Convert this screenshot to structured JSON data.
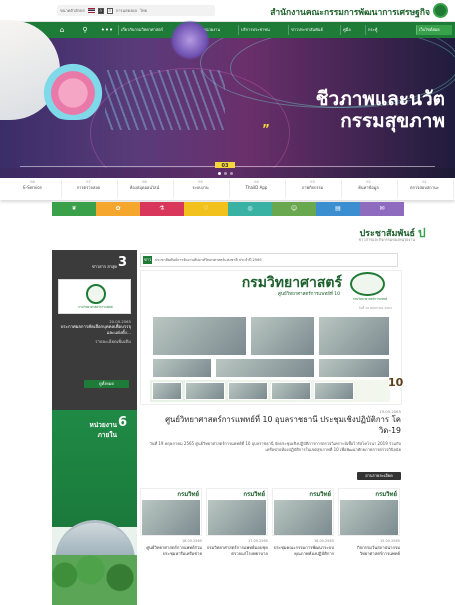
{
  "topbar": {
    "font_label": "ขนาดตัวอักษร",
    "contrast_label": "การแสดงผล",
    "lang_label": "ไทย",
    "size_a": "ก",
    "size_b": "ก",
    "site_title": "สำนักงานคณะกรรมการพัฒนาการเศรษฐกิจ",
    "nav_icons": [
      "home-icon",
      "search-icon",
      "more-icon"
    ],
    "nav_items": [
      "เกี่ยวกับกรมวิทยาศาสตร์",
      "ข้อมูลหน่วยงาน",
      "บริการประชาชน",
      "ข่าวประชาสัมพันธ์",
      "คู่มือ",
      "กระทู้"
    ],
    "nav_sub": "เว็บไซต์ย่อย"
  },
  "banner": {
    "title_line1": "ชีวภาพและนวัต",
    "title_line2": "กรรมสุขภาพ",
    "quote": "”",
    "slide_number": "03"
  },
  "quick_menu": [
    {
      "num": "01",
      "label": "ตรวจสอบสถานะ"
    },
    {
      "num": "02",
      "label": "ค้นหาข้อมูล"
    },
    {
      "num": "03",
      "label": "ภาพกิจกรรม"
    },
    {
      "num": "04",
      "label": "ThaiID App"
    },
    {
      "num": "05",
      "label": "ระบบงาน"
    },
    {
      "num": "06",
      "label": "ห้องสมุดออนไลน์"
    },
    {
      "num": "07",
      "label": "การตรวจสอบ"
    },
    {
      "num": "08",
      "label": "E-Service"
    }
  ],
  "colorbar": [
    {
      "icon": "leaf-icon",
      "color": "#3aa04a"
    },
    {
      "icon": "palette-icon",
      "color": "#f5a62d"
    },
    {
      "icon": "tube-icon",
      "color": "#d9365b"
    },
    {
      "icon": "heart-icon",
      "color": "#f3c11b"
    },
    {
      "icon": "globe-icon",
      "color": "#39b2a3"
    },
    {
      "icon": "people-icon",
      "color": "#6aa84f"
    },
    {
      "icon": "doc-icon",
      "color": "#3b8fd0"
    },
    {
      "icon": "chat-icon",
      "color": "#8e6bbf"
    }
  ],
  "section": {
    "title": "ประชาสัมพันธ์",
    "subtitle": "ข่าวสารและกิจกรรมของหน่วยงาน",
    "icon_letter": "ป"
  },
  "left_col": {
    "head_num": "3",
    "head_label": "ข่าวสาร ล่าสุด",
    "logo_text": "กรมวิทยาศาสตร์การแพทย์",
    "date": "20.05.2565",
    "text": "ประกาศผลการคัดเลือกบุคคลเพื่อบรรจุและแต่งตั้ง...",
    "text2": "รายละเอียดเพิ่มเติม",
    "button": "ดูทั้งหมด",
    "green_num": "6",
    "green_title": "หน่วยงานภายใน"
  },
  "news_bar": {
    "badge": "ข่าว",
    "text": "ประชาสัมพันธ์การจัดงานสัปดาห์วิทยาศาสตร์แห่งชาติ ประจำปี 2565"
  },
  "feature": {
    "np_title": "กรมวิทยาศาสตร์",
    "np_sub": "ศูนย์วิทยาศาสตร์การแพทย์ที่ 10",
    "np_logo_text": "กรมวิทยาศาสตร์การแพทย์",
    "meta": "วันที่ 19 พฤษภาคม 2565",
    "num": "10"
  },
  "news": {
    "date": "19.05.2565",
    "headline": "ศูนย์วิทยาศาสตร์การแพทย์ที่ 10 อุบลราชธานี ประชุมเชิงปฏิบัติการ โควิด-19",
    "body": "วันที่ 19 พฤษภาคม 2565 ศูนย์วิทยาศาสตร์การแพทย์ที่ 10 อุบลราชธานี จัดประชุมเชิงปฏิบัติการการตรวจวิเคราะห์เชื้อไวรัสโคโรนา 2019 ร่วมกับเครือข่ายห้องปฏิบัติการในเขตสุขภาพที่ 10 เพื่อพัฒนาศักยภาพการตรวจวินิจฉัย",
    "read_more": "อ่านรายละเอียด"
  },
  "thumbs": [
    {
      "hd": "กรมวิทย์",
      "date": "18.05.2565",
      "text": "ศูนย์วิทยาศาสตร์การแพทย์ร่วมประชุมหารือเครือข่าย"
    },
    {
      "hd": "กรมวิทย์",
      "date": "17.05.2565",
      "text": "กรมวิทยาศาสตร์การแพทย์มอบชุดตรวจแก่โรงพยาบาล"
    },
    {
      "hd": "กรมวิทย์",
      "date": "16.05.2565",
      "text": "ประชุมคณะกรรมการพัฒนาระบบคุณภาพห้องปฏิบัติการ"
    },
    {
      "hd": "กรมวิทย์",
      "date": "15.05.2565",
      "text": "กิจกรรมวันสถาปนากรมวิทยาศาสตร์การแพทย์"
    }
  ]
}
